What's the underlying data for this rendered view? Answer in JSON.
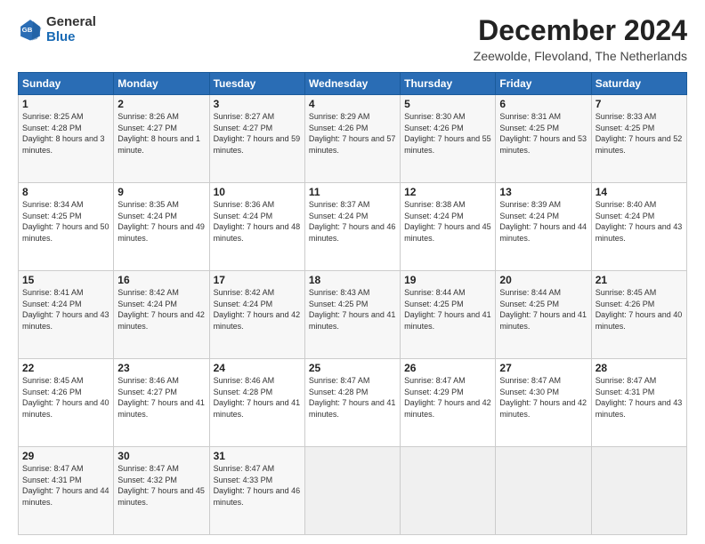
{
  "logo": {
    "general": "General",
    "blue": "Blue"
  },
  "title": "December 2024",
  "location": "Zeewolde, Flevoland, The Netherlands",
  "days_of_week": [
    "Sunday",
    "Monday",
    "Tuesday",
    "Wednesday",
    "Thursday",
    "Friday",
    "Saturday"
  ],
  "weeks": [
    [
      {
        "day": "1",
        "sunrise": "Sunrise: 8:25 AM",
        "sunset": "Sunset: 4:28 PM",
        "daylight": "Daylight: 8 hours and 3 minutes."
      },
      {
        "day": "2",
        "sunrise": "Sunrise: 8:26 AM",
        "sunset": "Sunset: 4:27 PM",
        "daylight": "Daylight: 8 hours and 1 minute."
      },
      {
        "day": "3",
        "sunrise": "Sunrise: 8:27 AM",
        "sunset": "Sunset: 4:27 PM",
        "daylight": "Daylight: 7 hours and 59 minutes."
      },
      {
        "day": "4",
        "sunrise": "Sunrise: 8:29 AM",
        "sunset": "Sunset: 4:26 PM",
        "daylight": "Daylight: 7 hours and 57 minutes."
      },
      {
        "day": "5",
        "sunrise": "Sunrise: 8:30 AM",
        "sunset": "Sunset: 4:26 PM",
        "daylight": "Daylight: 7 hours and 55 minutes."
      },
      {
        "day": "6",
        "sunrise": "Sunrise: 8:31 AM",
        "sunset": "Sunset: 4:25 PM",
        "daylight": "Daylight: 7 hours and 53 minutes."
      },
      {
        "day": "7",
        "sunrise": "Sunrise: 8:33 AM",
        "sunset": "Sunset: 4:25 PM",
        "daylight": "Daylight: 7 hours and 52 minutes."
      }
    ],
    [
      {
        "day": "8",
        "sunrise": "Sunrise: 8:34 AM",
        "sunset": "Sunset: 4:25 PM",
        "daylight": "Daylight: 7 hours and 50 minutes."
      },
      {
        "day": "9",
        "sunrise": "Sunrise: 8:35 AM",
        "sunset": "Sunset: 4:24 PM",
        "daylight": "Daylight: 7 hours and 49 minutes."
      },
      {
        "day": "10",
        "sunrise": "Sunrise: 8:36 AM",
        "sunset": "Sunset: 4:24 PM",
        "daylight": "Daylight: 7 hours and 48 minutes."
      },
      {
        "day": "11",
        "sunrise": "Sunrise: 8:37 AM",
        "sunset": "Sunset: 4:24 PM",
        "daylight": "Daylight: 7 hours and 46 minutes."
      },
      {
        "day": "12",
        "sunrise": "Sunrise: 8:38 AM",
        "sunset": "Sunset: 4:24 PM",
        "daylight": "Daylight: 7 hours and 45 minutes."
      },
      {
        "day": "13",
        "sunrise": "Sunrise: 8:39 AM",
        "sunset": "Sunset: 4:24 PM",
        "daylight": "Daylight: 7 hours and 44 minutes."
      },
      {
        "day": "14",
        "sunrise": "Sunrise: 8:40 AM",
        "sunset": "Sunset: 4:24 PM",
        "daylight": "Daylight: 7 hours and 43 minutes."
      }
    ],
    [
      {
        "day": "15",
        "sunrise": "Sunrise: 8:41 AM",
        "sunset": "Sunset: 4:24 PM",
        "daylight": "Daylight: 7 hours and 43 minutes."
      },
      {
        "day": "16",
        "sunrise": "Sunrise: 8:42 AM",
        "sunset": "Sunset: 4:24 PM",
        "daylight": "Daylight: 7 hours and 42 minutes."
      },
      {
        "day": "17",
        "sunrise": "Sunrise: 8:42 AM",
        "sunset": "Sunset: 4:24 PM",
        "daylight": "Daylight: 7 hours and 42 minutes."
      },
      {
        "day": "18",
        "sunrise": "Sunrise: 8:43 AM",
        "sunset": "Sunset: 4:25 PM",
        "daylight": "Daylight: 7 hours and 41 minutes."
      },
      {
        "day": "19",
        "sunrise": "Sunrise: 8:44 AM",
        "sunset": "Sunset: 4:25 PM",
        "daylight": "Daylight: 7 hours and 41 minutes."
      },
      {
        "day": "20",
        "sunrise": "Sunrise: 8:44 AM",
        "sunset": "Sunset: 4:25 PM",
        "daylight": "Daylight: 7 hours and 41 minutes."
      },
      {
        "day": "21",
        "sunrise": "Sunrise: 8:45 AM",
        "sunset": "Sunset: 4:26 PM",
        "daylight": "Daylight: 7 hours and 40 minutes."
      }
    ],
    [
      {
        "day": "22",
        "sunrise": "Sunrise: 8:45 AM",
        "sunset": "Sunset: 4:26 PM",
        "daylight": "Daylight: 7 hours and 40 minutes."
      },
      {
        "day": "23",
        "sunrise": "Sunrise: 8:46 AM",
        "sunset": "Sunset: 4:27 PM",
        "daylight": "Daylight: 7 hours and 41 minutes."
      },
      {
        "day": "24",
        "sunrise": "Sunrise: 8:46 AM",
        "sunset": "Sunset: 4:28 PM",
        "daylight": "Daylight: 7 hours and 41 minutes."
      },
      {
        "day": "25",
        "sunrise": "Sunrise: 8:47 AM",
        "sunset": "Sunset: 4:28 PM",
        "daylight": "Daylight: 7 hours and 41 minutes."
      },
      {
        "day": "26",
        "sunrise": "Sunrise: 8:47 AM",
        "sunset": "Sunset: 4:29 PM",
        "daylight": "Daylight: 7 hours and 42 minutes."
      },
      {
        "day": "27",
        "sunrise": "Sunrise: 8:47 AM",
        "sunset": "Sunset: 4:30 PM",
        "daylight": "Daylight: 7 hours and 42 minutes."
      },
      {
        "day": "28",
        "sunrise": "Sunrise: 8:47 AM",
        "sunset": "Sunset: 4:31 PM",
        "daylight": "Daylight: 7 hours and 43 minutes."
      }
    ],
    [
      {
        "day": "29",
        "sunrise": "Sunrise: 8:47 AM",
        "sunset": "Sunset: 4:31 PM",
        "daylight": "Daylight: 7 hours and 44 minutes."
      },
      {
        "day": "30",
        "sunrise": "Sunrise: 8:47 AM",
        "sunset": "Sunset: 4:32 PM",
        "daylight": "Daylight: 7 hours and 45 minutes."
      },
      {
        "day": "31",
        "sunrise": "Sunrise: 8:47 AM",
        "sunset": "Sunset: 4:33 PM",
        "daylight": "Daylight: 7 hours and 46 minutes."
      },
      null,
      null,
      null,
      null
    ]
  ]
}
